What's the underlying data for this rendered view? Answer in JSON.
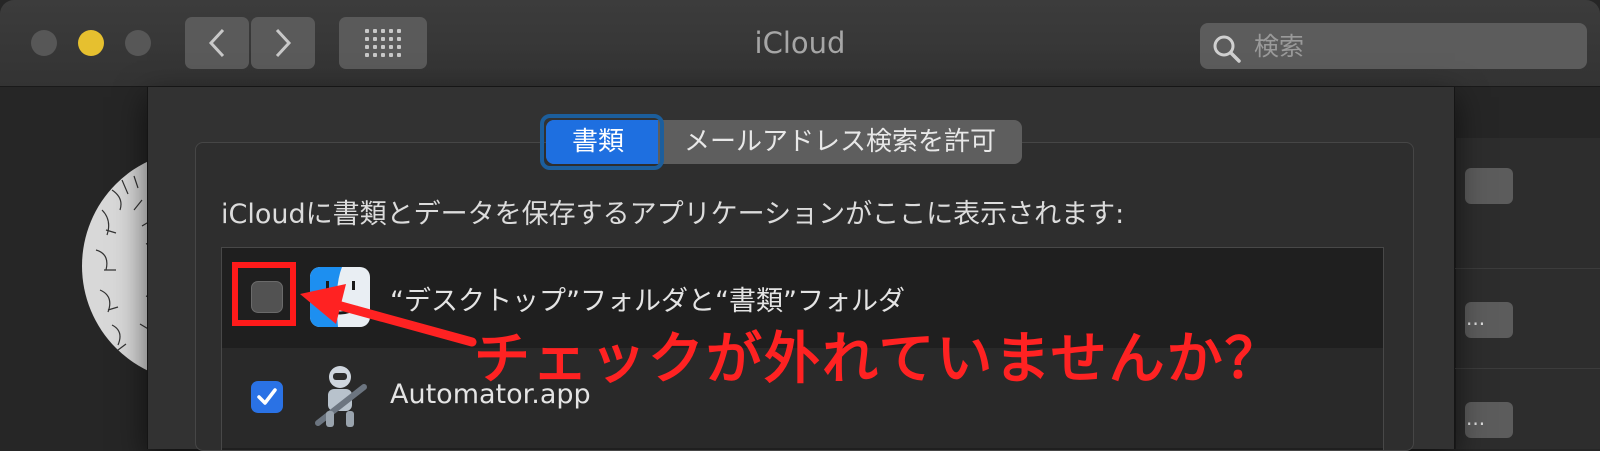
{
  "window": {
    "title": "iCloud"
  },
  "search": {
    "placeholder": "検索"
  },
  "tabs": [
    {
      "label": "書類",
      "selected": true
    },
    {
      "label": "メールアドレス検索を許可",
      "selected": false
    }
  ],
  "description": "iCloudに書類とデータを保存するアプリケーションがここに表示されます:",
  "apps": [
    {
      "label": "“デスクトップ”フォルダと“書類”フォルダ",
      "checked": false,
      "icon": "finder-icon"
    },
    {
      "label": "Automator.app",
      "checked": true,
      "icon": "automator-icon"
    }
  ],
  "annotation": {
    "text": "チェックが外れていませんか？",
    "color": "#ff2222"
  },
  "background": {
    "button_label": "..."
  },
  "colors": {
    "accent": "#1e6fe0",
    "window_bg": "#323232",
    "minimize": "#e6c02f"
  }
}
